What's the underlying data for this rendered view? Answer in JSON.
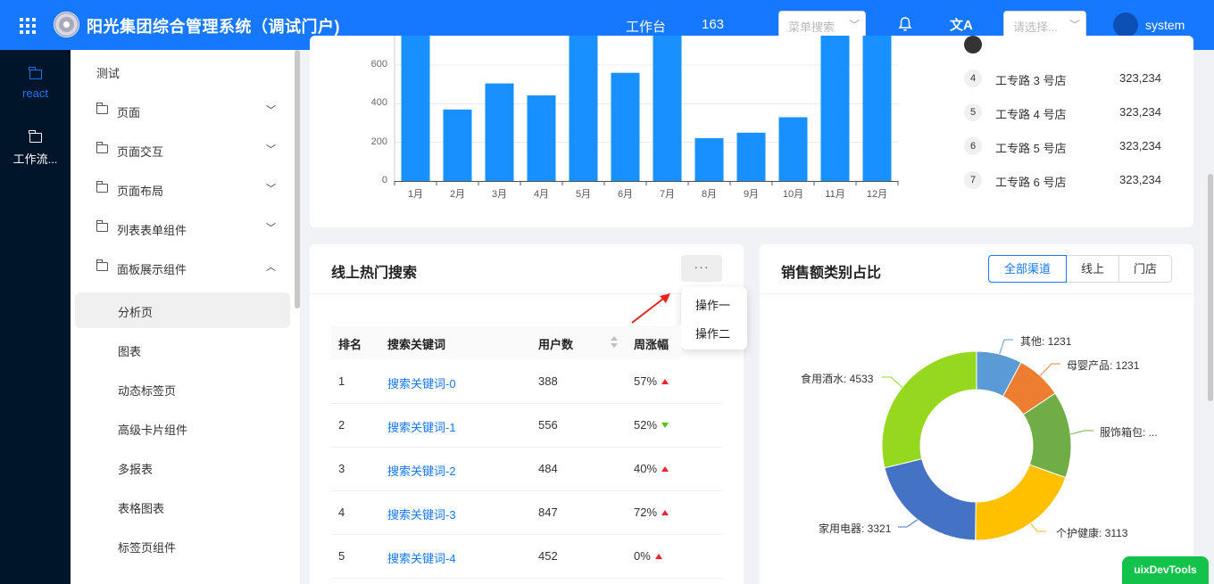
{
  "header": {
    "title": "阳光集团综合管理系统（调试门户)",
    "workspace": "工作台",
    "count": "163",
    "menu_search_placeholder": "菜单搜索",
    "select_placeholder": "请选择...",
    "user": "system"
  },
  "rail": {
    "items": [
      {
        "label": "react",
        "active": true
      },
      {
        "label": "工作流..."
      }
    ]
  },
  "menu": {
    "items": [
      {
        "label": "测试",
        "type": "plain"
      },
      {
        "label": "页面",
        "type": "folder",
        "arrow": "down"
      },
      {
        "label": "页面交互",
        "type": "folder",
        "arrow": "down"
      },
      {
        "label": "页面布局",
        "type": "folder",
        "arrow": "down"
      },
      {
        "label": "列表表单组件",
        "type": "folder",
        "arrow": "down"
      },
      {
        "label": "面板展示组件",
        "type": "folder",
        "arrow": "up"
      },
      {
        "label": "分析页",
        "type": "sub",
        "selected": true
      },
      {
        "label": "图表",
        "type": "sub"
      },
      {
        "label": "动态标签页",
        "type": "sub"
      },
      {
        "label": "高级卡片组件",
        "type": "sub"
      },
      {
        "label": "多报表",
        "type": "sub"
      },
      {
        "label": "表格图表",
        "type": "sub"
      },
      {
        "label": "标签页组件",
        "type": "sub"
      }
    ]
  },
  "chart_data": [
    {
      "type": "bar",
      "categories": [
        "1月",
        "2月",
        "3月",
        "4月",
        "5月",
        "6月",
        "7月",
        "8月",
        "9月",
        "10月",
        "11月",
        "12月"
      ],
      "values": [
        760,
        370,
        505,
        443,
        760,
        560,
        760,
        222,
        250,
        330,
        760,
        760
      ],
      "yticks": [
        "0",
        "200",
        "400",
        "600"
      ],
      "ylim": [
        0,
        800
      ],
      "color": "#1890ff"
    },
    {
      "type": "pie",
      "title": "销售额类别占比",
      "donut": true,
      "slices": [
        {
          "label": "其他: 1231",
          "value": 1231,
          "color": "#5b9bd5"
        },
        {
          "label": "母婴产品: 1231",
          "value": 1231,
          "color": "#ed7d31"
        },
        {
          "label": "服饰箱包: ...",
          "value": 2341,
          "color": "#70ad47"
        },
        {
          "label": "个护健康: 3113",
          "value": 3113,
          "color": "#ffc000"
        },
        {
          "label": "家用电器: 3321",
          "value": 3321,
          "color": "#4472c4"
        },
        {
          "label": "食用酒水: 4533",
          "value": 4533,
          "color": "#96d81f"
        }
      ]
    }
  ],
  "ranking": {
    "items": [
      {
        "num": "4",
        "name": "工专路 3 号店",
        "value": "323,234"
      },
      {
        "num": "5",
        "name": "工专路 4 号店",
        "value": "323,234"
      },
      {
        "num": "6",
        "name": "工专路 5 号店",
        "value": "323,234"
      },
      {
        "num": "7",
        "name": "工专路 6 号店",
        "value": "323,234"
      }
    ]
  },
  "search_card": {
    "title": "线上热门搜索",
    "more": "···",
    "dropdown": [
      "操作一",
      "操作二"
    ],
    "columns": [
      "排名",
      "搜索关键词",
      "用户数",
      "周涨幅"
    ],
    "rows": [
      {
        "rank": "1",
        "keyword": "搜索关键词-0",
        "users": "388",
        "change": "57%",
        "trend": "up"
      },
      {
        "rank": "2",
        "keyword": "搜索关键词-1",
        "users": "556",
        "change": "52%",
        "trend": "down"
      },
      {
        "rank": "3",
        "keyword": "搜索关键词-2",
        "users": "484",
        "change": "40%",
        "trend": "up"
      },
      {
        "rank": "4",
        "keyword": "搜索关键词-3",
        "users": "847",
        "change": "72%",
        "trend": "up"
      },
      {
        "rank": "5",
        "keyword": "搜索关键词-4",
        "users": "452",
        "change": "0%",
        "trend": "up"
      }
    ]
  },
  "sales_card": {
    "title": "销售额类别占比",
    "tabs": [
      "全部渠道",
      "线上",
      "门店"
    ],
    "active_tab": 0
  },
  "devtools": "uixDevTools"
}
